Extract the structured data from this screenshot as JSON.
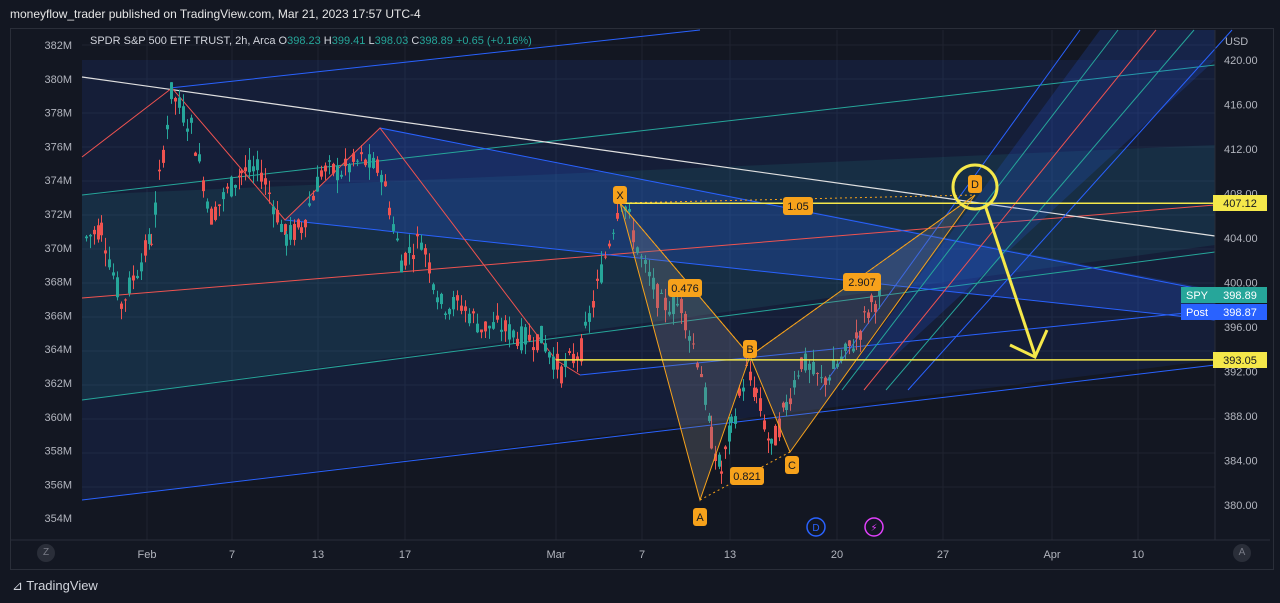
{
  "header": {
    "text": "moneyflow_trader published on TradingView.com, Mar 21, 2023 17:57 UTC-4"
  },
  "symbol_line": {
    "name": "SPDR S&P 500 ETF TRUST, 2h, Arca",
    "o_label": "O",
    "o_value": "398.23",
    "h_label": "H",
    "h_value": "399.41",
    "l_label": "L",
    "l_value": "398.03",
    "c_label": "C",
    "c_value": "398.89",
    "change": "+0.65 (+0.16%)"
  },
  "colors": {
    "up": "#26a69a",
    "down": "#ef5350",
    "yellow": "#f5e84a",
    "orange": "#f7a21b",
    "blue_pitch": "#2962ff",
    "background": "#131722"
  },
  "chart_data": {
    "type": "candlestick",
    "price_axis": {
      "unit_label": "USD",
      "ticks": [
        "420.00",
        "416.00",
        "412.00",
        "408.00",
        "404.00",
        "400.00",
        "396.00",
        "392.00",
        "388.00",
        "384.00",
        "380.00"
      ]
    },
    "volume_axis": {
      "ticks": [
        "382M",
        "380M",
        "378M",
        "376M",
        "374M",
        "372M",
        "370M",
        "368M",
        "366M",
        "364M",
        "362M",
        "360M",
        "358M",
        "356M",
        "354M"
      ]
    },
    "time_axis": {
      "ticks": [
        "Feb",
        "7",
        "13",
        "17",
        "Mar",
        "7",
        "13",
        "20",
        "27",
        "Apr",
        "10"
      ]
    },
    "price_labels": [
      {
        "name": "SPY",
        "value": "398.89",
        "color": "#26a69a"
      },
      {
        "name": "Post",
        "value": "398.87",
        "color": "#2962ff"
      },
      {
        "name": "",
        "value": "407.12",
        "color": "#f5e84a"
      },
      {
        "name": "",
        "value": "393.05",
        "color": "#f5e84a"
      }
    ],
    "harmonic_pattern": {
      "points": [
        {
          "label": "X",
          "price": 408.0
        },
        {
          "label": "A",
          "price": 380.0
        },
        {
          "label": "B",
          "price": 393.0
        },
        {
          "label": "C",
          "price": 385.0
        },
        {
          "label": "D",
          "price": 408.0
        }
      ],
      "ratios": [
        "0.476",
        "0.821",
        "2.907",
        "1.05"
      ]
    },
    "horizontal_lines": [
      407.12,
      393.05
    ],
    "bottom_badges": [
      "D",
      "⚡"
    ]
  },
  "footer": {
    "brand": "TradingView",
    "left_btn": "Z",
    "right_btn": "A"
  }
}
